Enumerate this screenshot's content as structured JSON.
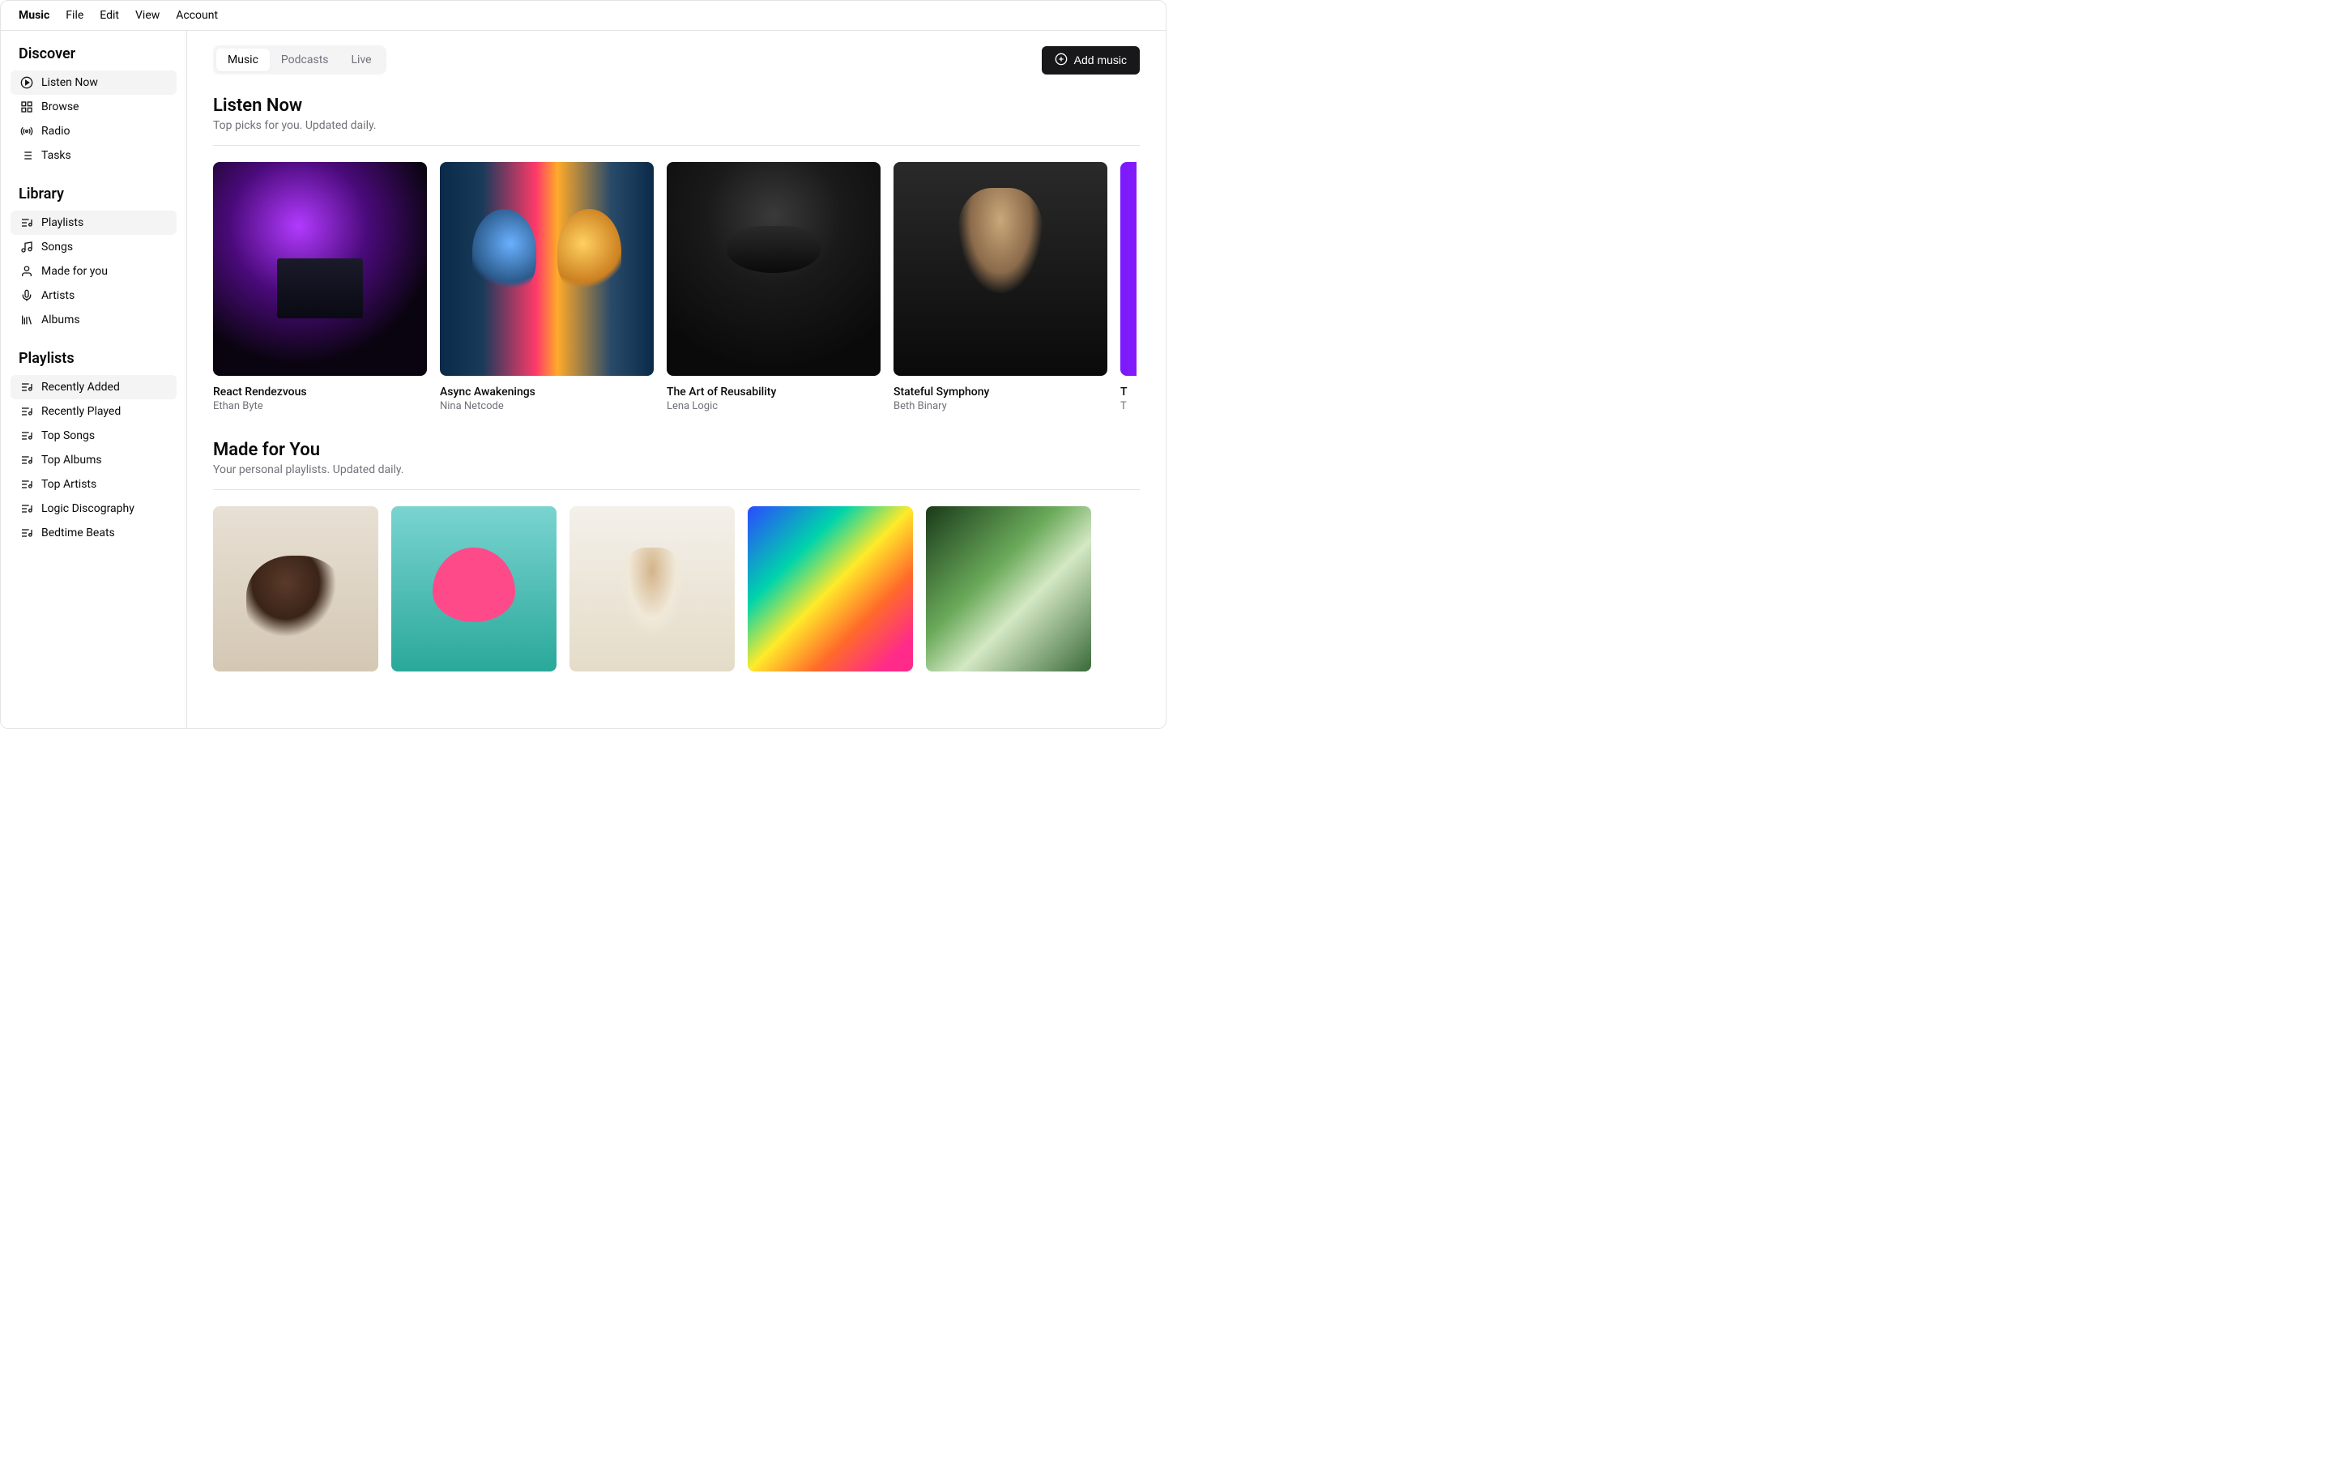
{
  "menubar": [
    "Music",
    "File",
    "Edit",
    "View",
    "Account"
  ],
  "sidebar": {
    "sections": [
      {
        "title": "Discover",
        "items": [
          {
            "label": "Listen Now",
            "icon": "play-circle-icon",
            "active": true
          },
          {
            "label": "Browse",
            "icon": "grid-icon",
            "active": false
          },
          {
            "label": "Radio",
            "icon": "radio-icon",
            "active": false
          },
          {
            "label": "Tasks",
            "icon": "list-icon",
            "active": false
          }
        ]
      },
      {
        "title": "Library",
        "items": [
          {
            "label": "Playlists",
            "icon": "playlist-icon",
            "active": true
          },
          {
            "label": "Songs",
            "icon": "music-note-icon",
            "active": false
          },
          {
            "label": "Made for you",
            "icon": "user-icon",
            "active": false
          },
          {
            "label": "Artists",
            "icon": "mic-icon",
            "active": false
          },
          {
            "label": "Albums",
            "icon": "library-icon",
            "active": false
          }
        ]
      },
      {
        "title": "Playlists",
        "items": [
          {
            "label": "Recently Added",
            "icon": "playlist-icon",
            "active": true
          },
          {
            "label": "Recently Played",
            "icon": "playlist-icon",
            "active": false
          },
          {
            "label": "Top Songs",
            "icon": "playlist-icon",
            "active": false
          },
          {
            "label": "Top Albums",
            "icon": "playlist-icon",
            "active": false
          },
          {
            "label": "Top Artists",
            "icon": "playlist-icon",
            "active": false
          },
          {
            "label": "Logic Discography",
            "icon": "playlist-icon",
            "active": false
          },
          {
            "label": "Bedtime Beats",
            "icon": "playlist-icon",
            "active": false
          }
        ]
      }
    ]
  },
  "tabs": [
    {
      "label": "Music",
      "active": true
    },
    {
      "label": "Podcasts",
      "active": false
    },
    {
      "label": "Live",
      "active": false
    }
  ],
  "add_button": "Add music",
  "listen_now": {
    "title": "Listen Now",
    "subtitle": "Top picks for you. Updated daily.",
    "cards": [
      {
        "title": "React Rendezvous",
        "artist": "Ethan Byte"
      },
      {
        "title": "Async Awakenings",
        "artist": "Nina Netcode"
      },
      {
        "title": "The Art of Reusability",
        "artist": "Lena Logic"
      },
      {
        "title": "Stateful Symphony",
        "artist": "Beth Binary"
      },
      {
        "title": "T",
        "artist": "T"
      }
    ]
  },
  "made_for_you": {
    "title": "Made for You",
    "subtitle": "Your personal playlists. Updated daily."
  }
}
